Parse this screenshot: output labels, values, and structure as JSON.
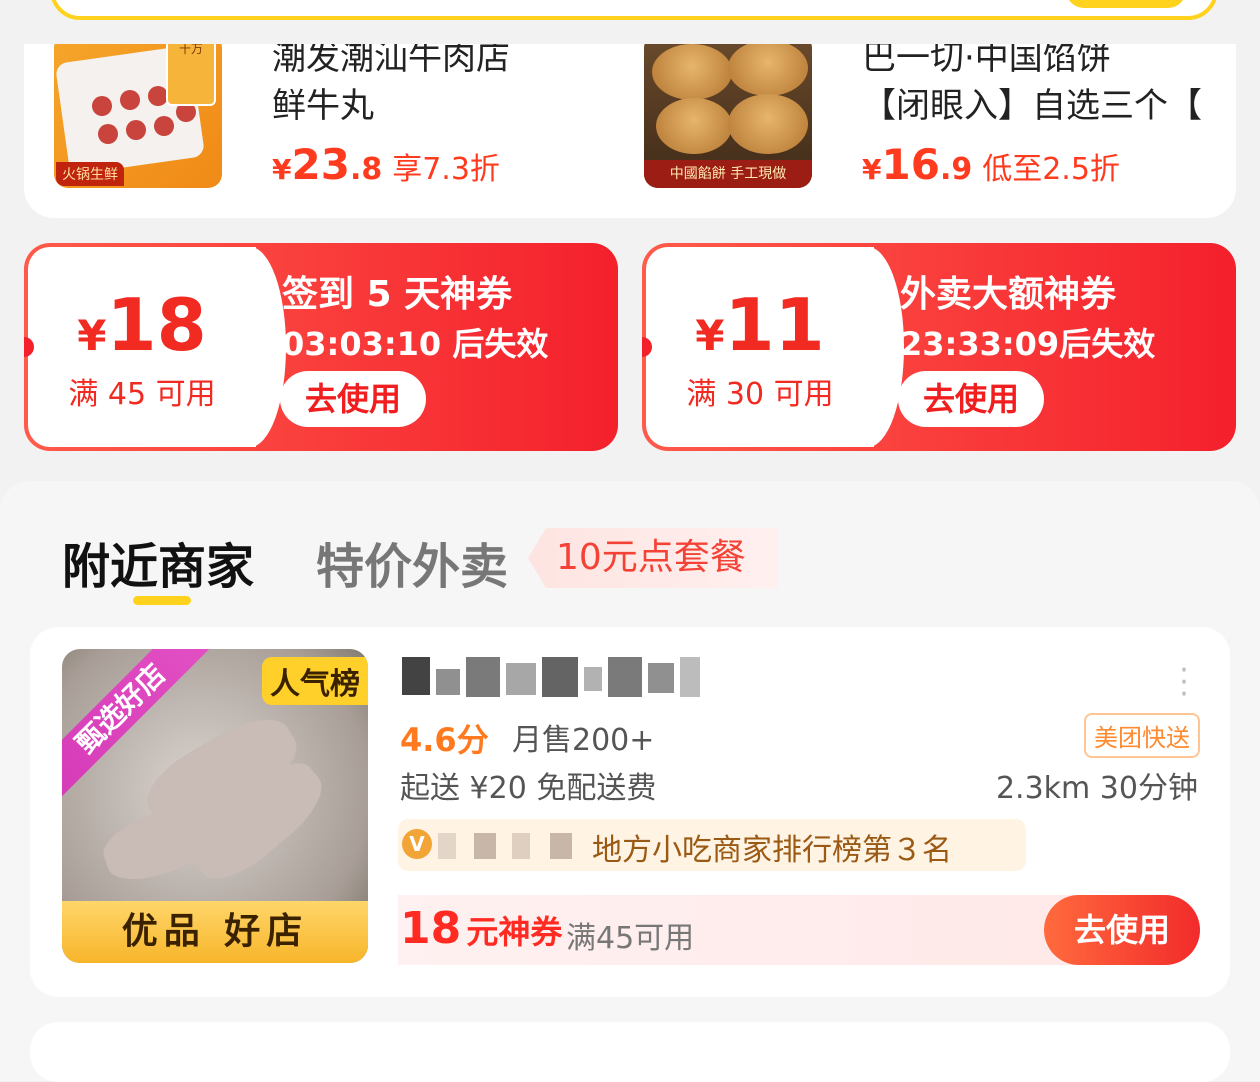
{
  "deals": [
    {
      "shop_name": "潮发潮汕牛肉店",
      "item": "鲜牛丸",
      "price_currency": "¥",
      "price_int": "23",
      "price_dec": ".8",
      "discount": "享7.3折",
      "image_tag": "火锅生鲜",
      "image_pack": "十万"
    },
    {
      "shop_name": "巴一切·中国馅饼",
      "item": "【闭眼入】自选三个【",
      "price_currency": "¥",
      "price_int": "16",
      "price_dec": ".9",
      "discount": "低至2.5折",
      "image_tag": "中國餡餅 手工現做"
    }
  ],
  "coupons": [
    {
      "currency": "¥",
      "amount": "18",
      "condition": "满 45 可用",
      "title": "签到 5 天神券",
      "timer": "03:03:10 后失效",
      "action": "去使用"
    },
    {
      "currency": "¥",
      "amount": "11",
      "condition": "满 30 可用",
      "title": "外卖大额神券",
      "timer": "23:33:09后失效",
      "action": "去使用"
    }
  ],
  "nearby": {
    "tabs": [
      "附近商家",
      "特价外卖"
    ],
    "promo_tag": "10元点套餐"
  },
  "shop": {
    "ribbon": "甄选好店",
    "badge": "人气榜",
    "banner": "优品 好店",
    "score": "4.6分",
    "monthly_sales": "月售200+",
    "delivery_badge": "美团快送",
    "min_order": "起送 ¥20  免配送费",
    "distance_time": "2.3km 30分钟",
    "rank_text": "地方小吃商家排行榜第３名",
    "coupon_amount": "18",
    "coupon_label": "元神券",
    "coupon_condition": "满45可用",
    "coupon_action": "去使用"
  },
  "colors": {
    "accent_red": "#f4202c",
    "brand_yellow": "#ffd21e",
    "price_red": "#ff3b1f",
    "score_orange": "#ff7a1f"
  }
}
